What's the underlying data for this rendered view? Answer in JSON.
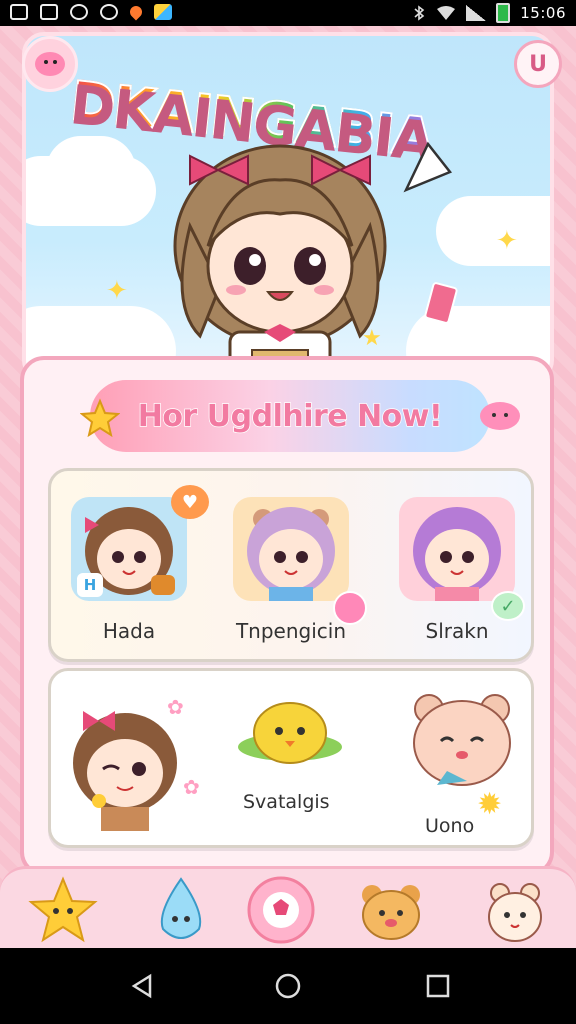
{
  "status_bar": {
    "time": "15:06",
    "left_icons": [
      "image-icon",
      "image-icon",
      "shield-icon",
      "sync-icon",
      "app-notification-icon",
      "app-notification-icon"
    ],
    "right_icons": [
      "bluetooth-icon",
      "wifi-icon",
      "signal-icon",
      "battery-icon"
    ]
  },
  "header": {
    "logo_text": "DKAINGABIA",
    "right_button_label": "U"
  },
  "banner": {
    "title": "Hor Ugdlhire Now!"
  },
  "row1": [
    {
      "name": "Hada",
      "hair": "#8a5a3a",
      "bg": "#bfe4f6",
      "badge": "speech"
    },
    {
      "name": "Tnpengicin",
      "hair": "#c9a3d8",
      "bg": "#fde2b8",
      "badge": "heart"
    },
    {
      "name": "Slrakn",
      "hair": "#b57bd6",
      "bg": "#ffd0da",
      "badge": "check"
    }
  ],
  "row2": [
    {
      "name": "",
      "kind": "girl-wink"
    },
    {
      "name": "Svatalgis",
      "kind": "yellow-bird"
    },
    {
      "name": "Uono",
      "kind": "pink-bear"
    }
  ],
  "tag_label": "H",
  "dock": [
    "star-icon",
    "droplet-icon",
    "flower-icon",
    "bear-icon",
    "bunny-icon"
  ],
  "colors": {
    "accent": "#f27aa1",
    "frame": "#f3a7bd"
  }
}
